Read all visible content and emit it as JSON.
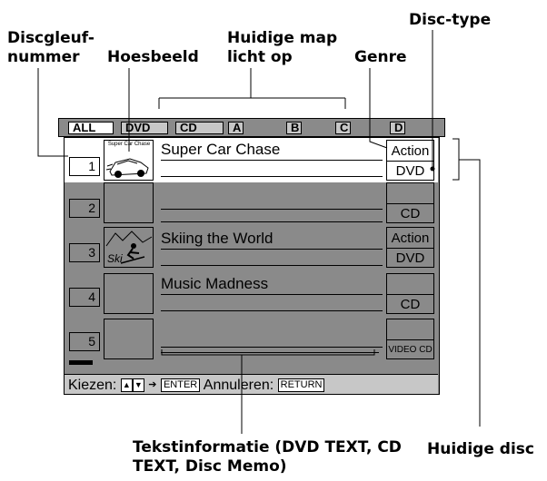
{
  "callouts": {
    "slot_number_line1": "Discgleuf-",
    "slot_number_line2": "nummer",
    "cover_image": "Hoesbeeld",
    "current_folder_line1": "Huidige map",
    "current_folder_line2": "licht op",
    "genre": "Genre",
    "disc_type": "Disc-type",
    "text_info_line1": "Tekstinformatie (DVD TEXT, CD",
    "text_info_line2": "TEXT, Disc Memo)",
    "current_disc": "Huidige disc"
  },
  "tabs": [
    "ALL",
    "DVD",
    "CD",
    "A",
    "B",
    "C",
    "D"
  ],
  "rows": [
    {
      "number": "1",
      "cover_caption": "Super Car Chase",
      "title": "Super Car Chase",
      "genre": "Action",
      "type": "DVD"
    },
    {
      "number": "2",
      "cover_caption": "",
      "title": "",
      "genre": "",
      "type": "CD"
    },
    {
      "number": "3",
      "cover_caption": "Ski",
      "title": "Skiing the World",
      "genre": "Action",
      "type": "DVD"
    },
    {
      "number": "4",
      "cover_caption": "",
      "title": "Music Madness",
      "genre": "",
      "type": "CD"
    },
    {
      "number": "5",
      "cover_caption": "",
      "title": "",
      "genre": "",
      "type": "VIDEO CD"
    }
  ],
  "bottom": {
    "select_label": "Kiezen:",
    "enter_key": "ENTER",
    "cancel_label": "Annuleren:",
    "return_key": "RETURN"
  },
  "icons": [
    "arrow-up-icon",
    "arrow-down-icon",
    "arrow-right-icon",
    "race-car-icon",
    "skier-icon"
  ]
}
